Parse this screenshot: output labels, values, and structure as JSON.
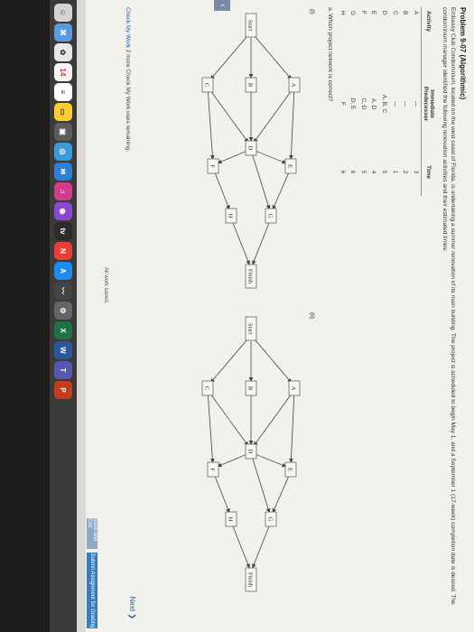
{
  "problem": {
    "title": "Problem 9-07 (Algorithmic)",
    "intro": "Embassy Club Condominium, located on the west coast of Florida, is undertaking a summer renovation of its main building. The project is scheduled to begin May 1, and a September 1 (17-week) completion date is desired. The condominium manager identified the following renovation activities and their estimated times:"
  },
  "table": {
    "headers": {
      "activity": "Activity",
      "immediate": "Immediate",
      "predecessor": "Predecessor",
      "time": "Time"
    },
    "rows": [
      {
        "activity": "A",
        "pred": "—",
        "time": "3"
      },
      {
        "activity": "B",
        "pred": "—",
        "time": "2"
      },
      {
        "activity": "C",
        "pred": "—",
        "time": "1"
      },
      {
        "activity": "D",
        "pred": "A, B, C",
        "time": "5"
      },
      {
        "activity": "E",
        "pred": "A, D",
        "time": "4"
      },
      {
        "activity": "F",
        "pred": "C, D",
        "time": "5"
      },
      {
        "activity": "G",
        "pred": "D, E",
        "time": "6"
      },
      {
        "activity": "H",
        "pred": "F",
        "time": "6"
      }
    ]
  },
  "question": "a. Which project network is correct?",
  "options": {
    "i": "(i)",
    "ii": "(ii)"
  },
  "nodes": {
    "start": "Start",
    "finish": "Finish",
    "A": "A",
    "B": "B",
    "C": "C",
    "D": "D",
    "E": "E",
    "F": "F",
    "G": "G",
    "H": "H"
  },
  "footer": {
    "check_link": "Check My Work",
    "check_rest": "2 more Check My Work uses remaining.",
    "next": "Next",
    "saved": "All work saved.",
    "save_exit": "Save and Exit",
    "submit": "Submit Assignment for Grading"
  },
  "dock": {
    "calendar_day": "14",
    "tv": "tv"
  },
  "colors": {
    "node_fill": "#f6f6f4",
    "node_stroke": "#555555",
    "link": "#1b5fb3",
    "submit_bg": "#3a7bbf",
    "save_bg": "#8fa9c6"
  }
}
